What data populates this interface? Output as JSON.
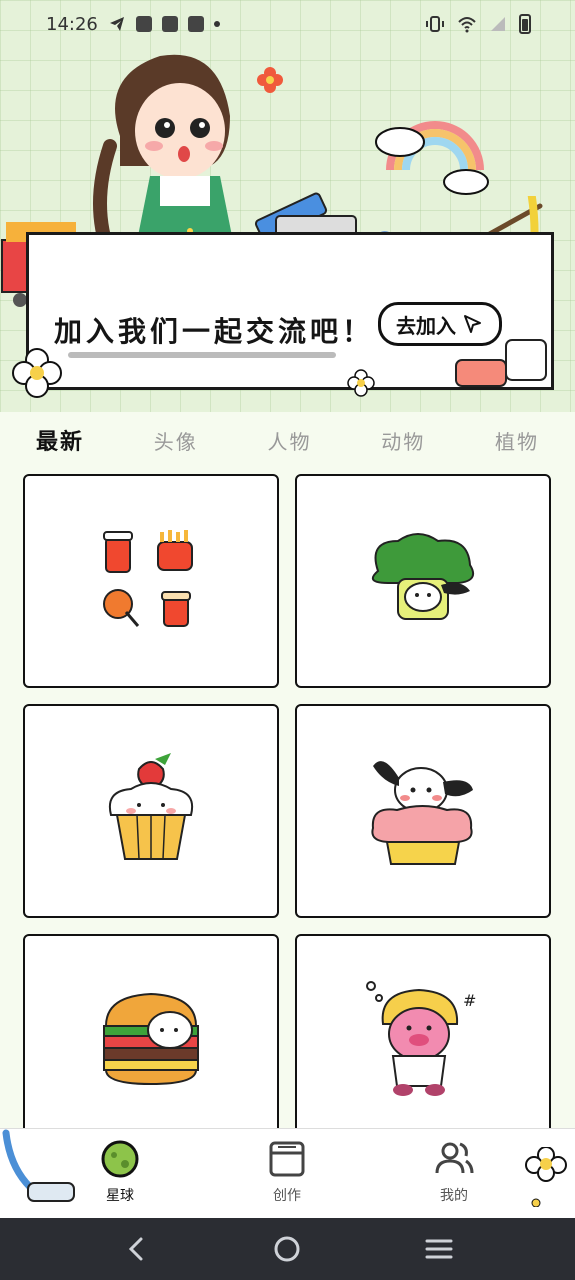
{
  "status_bar": {
    "time": "14:26"
  },
  "banner": {
    "title": "加入我们一起交流吧！",
    "join_button": "去加入"
  },
  "tabs": [
    {
      "label": "最新",
      "active": true
    },
    {
      "label": "头像",
      "active": false
    },
    {
      "label": "人物",
      "active": false
    },
    {
      "label": "动物",
      "active": false
    },
    {
      "label": "植物",
      "active": false
    }
  ],
  "cards": [
    {
      "icon": "food-drinks-icon"
    },
    {
      "icon": "broccoli-puppy-icon"
    },
    {
      "icon": "strawberry-cupcake-icon"
    },
    {
      "icon": "puppy-cupcake-icon"
    },
    {
      "icon": "hamburger-cat-icon"
    },
    {
      "icon": "pink-creature-icon"
    }
  ],
  "bottom_nav": {
    "planet": "星球",
    "create": "创作",
    "mine": "我的"
  },
  "colors": {
    "accent": "#8dc44a",
    "background": "#f6fbef",
    "system_nav": "#2b2d33"
  }
}
